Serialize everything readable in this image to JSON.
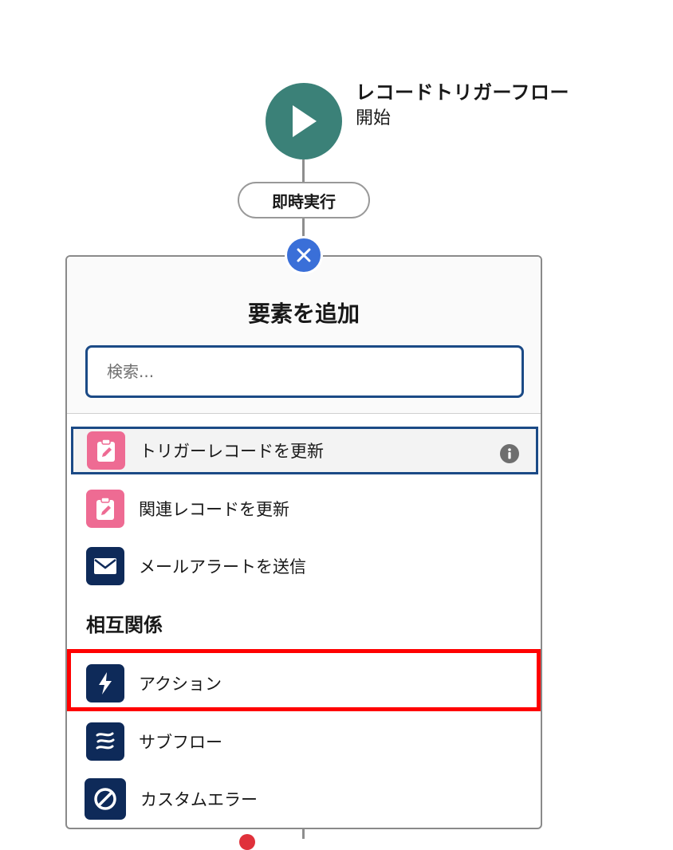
{
  "flow_start": {
    "title": "レコードトリガーフロー",
    "subtitle": "開始"
  },
  "run_path": {
    "label": "即時実行"
  },
  "panel": {
    "title": "要素を追加",
    "search": {
      "placeholder": "検索...",
      "value": ""
    },
    "items": [
      {
        "label": "トリガーレコードを更新",
        "icon": "record-update-icon",
        "color": "#ee6b93",
        "selected": true
      },
      {
        "label": "関連レコードを更新",
        "icon": "record-update-icon",
        "color": "#ee6b93"
      },
      {
        "label": "メールアラートを送信",
        "icon": "email-icon",
        "color": "#0e2a59"
      }
    ],
    "section_heading": "相互関係",
    "interaction_items": [
      {
        "label": "アクション",
        "icon": "lightning-icon",
        "color": "#0e2a59",
        "highlighted": true
      },
      {
        "label": "サブフロー",
        "icon": "subflow-icon",
        "color": "#0e2a59"
      },
      {
        "label": "カスタムエラー",
        "icon": "ban-icon",
        "color": "#0e2a59"
      }
    ]
  },
  "colors": {
    "start_node": "#3b8178",
    "close_button": "#3a6fd8",
    "selection_border": "#1b4a86",
    "highlight_border": "#ff0000"
  }
}
